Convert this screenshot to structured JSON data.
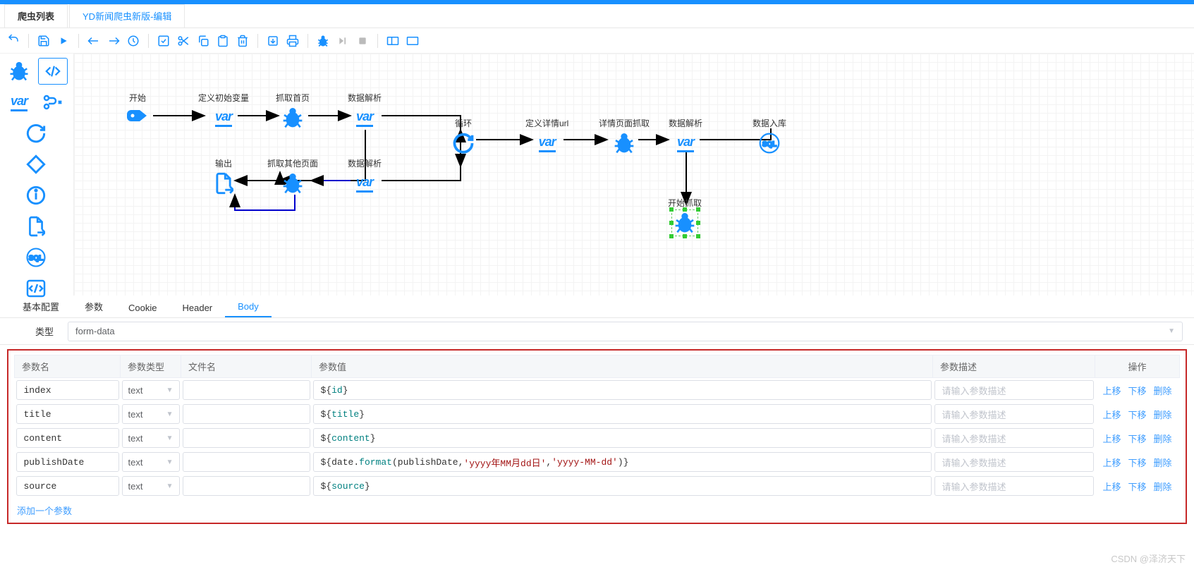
{
  "tabs": {
    "main": "爬虫列表",
    "edit": "YD新闻爬虫新版-编辑"
  },
  "palette_var_text": "var",
  "nodes": {
    "start": "开始",
    "init_var": "定义初始变量",
    "fetch_home": "抓取首页",
    "parse1": "数据解析",
    "output": "输出",
    "fetch_other": "抓取其他页面",
    "parse2": "数据解析",
    "loop": "循环",
    "detail_url": "定义详情url",
    "detail_fetch": "详情页面抓取",
    "parse3": "数据解析",
    "store": "数据入库",
    "start_fetch": "开始抓取",
    "var_text": "var"
  },
  "config_tabs": {
    "basic": "基本配置",
    "params": "参数",
    "cookie": "Cookie",
    "header": "Header",
    "body": "Body"
  },
  "type_label": "类型",
  "type_value": "form-data",
  "columns": {
    "name": "参数名",
    "ptype": "参数类型",
    "file": "文件名",
    "value": "参数值",
    "desc": "参数描述",
    "ops": "操作"
  },
  "desc_placeholder": "请输入参数描述",
  "rows": [
    {
      "name": "index",
      "ptype": "text",
      "value_raw": "${id}",
      "value_tokens": [
        {
          "c": "sym",
          "t": "${"
        },
        {
          "c": "teal",
          "t": "id"
        },
        {
          "c": "sym",
          "t": "}"
        }
      ]
    },
    {
      "name": "title",
      "ptype": "text",
      "value_raw": "${title}",
      "value_tokens": [
        {
          "c": "sym",
          "t": "${"
        },
        {
          "c": "teal",
          "t": "title"
        },
        {
          "c": "sym",
          "t": "}"
        }
      ]
    },
    {
      "name": "content",
      "ptype": "text",
      "value_raw": "${content}",
      "value_tokens": [
        {
          "c": "sym",
          "t": "${"
        },
        {
          "c": "teal",
          "t": "content"
        },
        {
          "c": "sym",
          "t": "}"
        }
      ]
    },
    {
      "name": "publishDate",
      "ptype": "text",
      "value_raw": "${date.format(publishDate,'yyyy年MM月dd日','yyyy-MM-dd')}",
      "value_tokens": [
        {
          "c": "sym",
          "t": "${"
        },
        {
          "c": "dark",
          "t": "date"
        },
        {
          "c": "sym",
          "t": "."
        },
        {
          "c": "teal",
          "t": "format"
        },
        {
          "c": "sym",
          "t": "("
        },
        {
          "c": "dark",
          "t": "publishDate"
        },
        {
          "c": "sym",
          "t": ","
        },
        {
          "c": "str",
          "t": "'yyyy年MM月dd日'"
        },
        {
          "c": "sym",
          "t": ","
        },
        {
          "c": "str",
          "t": "'yyyy-MM-dd'"
        },
        {
          "c": "sym",
          "t": ")}"
        }
      ]
    },
    {
      "name": "source",
      "ptype": "text",
      "value_raw": "${source}",
      "value_tokens": [
        {
          "c": "sym",
          "t": "${"
        },
        {
          "c": "teal",
          "t": "source"
        },
        {
          "c": "sym",
          "t": "}"
        }
      ]
    }
  ],
  "ops": {
    "up": "上移",
    "down": "下移",
    "del": "删除"
  },
  "add_param": "添加一个参数",
  "watermark": "CSDN @泽济天下"
}
